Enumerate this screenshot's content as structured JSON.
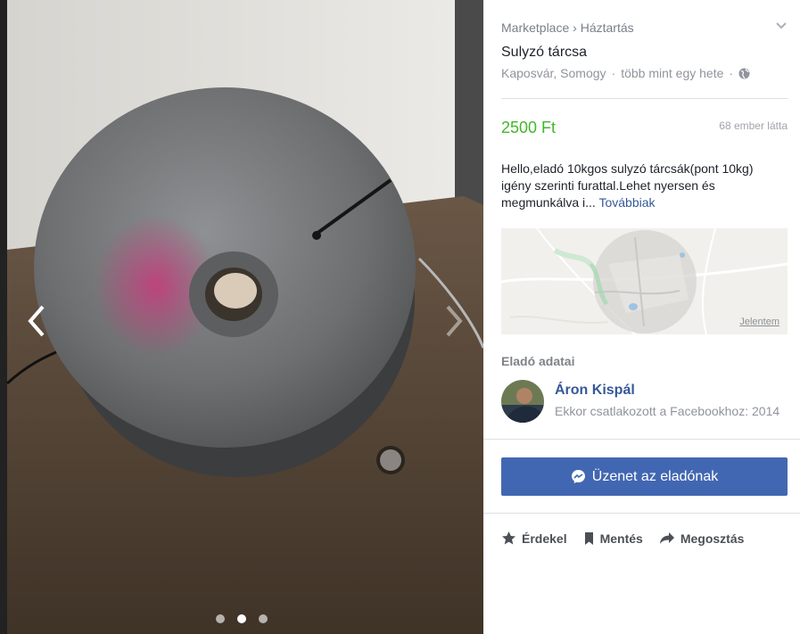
{
  "breadcrumb": {
    "marketplace": "Marketplace",
    "separator": "›",
    "category": "Háztartás"
  },
  "listing": {
    "title": "Sulyzó tárcsa",
    "location": "Kaposvár, Somogy",
    "posted": "több mint egy hete",
    "meta_separator": "·",
    "price": "2500 Ft",
    "views": "68 ember látta",
    "description": "Hello,eladó 10kgos sulyzó tárcsák(pont 10kg) igény szerinti furattal.Lehet nyersen és megmunkálva i...",
    "more_label": "Továbbiak"
  },
  "map": {
    "report_label": "Jelentem"
  },
  "seller": {
    "heading": "Eladó adatai",
    "name": "Áron Kispál",
    "joined": "Ekkor csatlakozott a Facebookhoz: 2014"
  },
  "message_button": "Üzenet az eladónak",
  "actions": {
    "interested": "Érdekel",
    "save": "Mentés",
    "share": "Megosztás"
  },
  "carousel": {
    "image_count": 3,
    "active_index": 1
  },
  "colors": {
    "price": "#42b72a",
    "button": "#4267b2",
    "link": "#365899"
  },
  "icons": [
    "chevron-left-icon",
    "chevron-right-icon",
    "chevron-down-icon",
    "globe-icon",
    "messenger-icon",
    "star-icon",
    "bookmark-icon",
    "share-arrow-icon"
  ]
}
